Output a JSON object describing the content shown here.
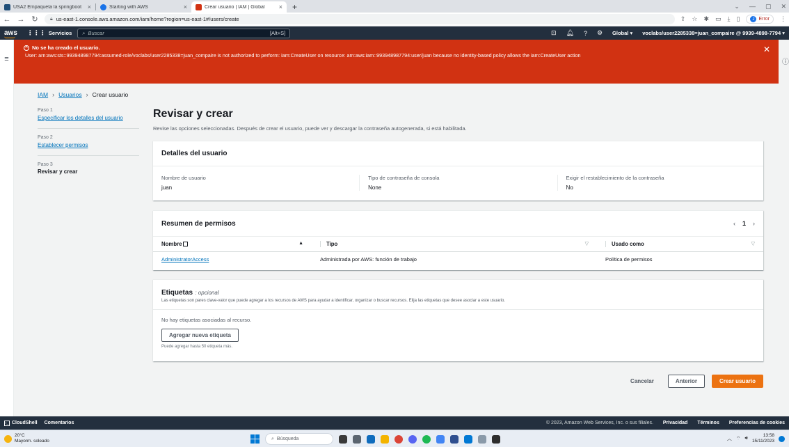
{
  "browser": {
    "tabs": [
      {
        "title": "USA2 Empaqueta la springboot",
        "active": false,
        "favicon_color": "#1f4e79"
      },
      {
        "title": "Starting with AWS",
        "active": false,
        "favicon_color": "#1a73e8"
      },
      {
        "title": "Crear usuario | IAM | Global",
        "active": true,
        "favicon_color": "#d13212"
      }
    ],
    "new_tab": "+",
    "url": "us-east-1.console.aws.amazon.com/iam/home?region=us-east-1#/users/create",
    "profile_label": "Error",
    "profile_initial": "J"
  },
  "aws_nav": {
    "logo": "aws",
    "services": "Servicios",
    "search_placeholder": "Buscar",
    "search_shortcut": "[Alt+S]",
    "region": "Global",
    "account": "voclabs/user2285338=juan_compaire @ 9939-4898-7794"
  },
  "flash": {
    "title": "No se ha creado el usuario.",
    "message": "User: arn:aws:sts::993948987794:assumed-role/voclabs/user2285338=juan_compaire is not authorized to perform: iam:CreateUser on resource: arn:aws:iam::993948987794:user/juan because no identity-based policy allows the iam:CreateUser action"
  },
  "breadcrumb": {
    "items": [
      "IAM",
      "Usuarios"
    ],
    "current": "Crear usuario"
  },
  "steps": [
    {
      "label": "Paso 1",
      "title": "Especificar los detalles del usuario",
      "is_link": true
    },
    {
      "label": "Paso 2",
      "title": "Establecer permisos",
      "is_link": true
    },
    {
      "label": "Paso 3",
      "title": "Revisar y crear",
      "is_link": false
    }
  ],
  "page": {
    "title": "Revisar y crear",
    "description": "Revise las opciones seleccionadas. Después de crear el usuario, puede ver y descargar la contraseña autogenerada, si está habilitada."
  },
  "user_details": {
    "heading": "Detalles del usuario",
    "fields": [
      {
        "key": "Nombre de usuario",
        "value": "juan"
      },
      {
        "key": "Tipo de contraseña de consola",
        "value": "None"
      },
      {
        "key": "Exigir el restablecimiento de la contraseña",
        "value": "No"
      }
    ]
  },
  "permissions": {
    "heading": "Resumen de permisos",
    "page": "1",
    "columns": [
      "Nombre",
      "Tipo",
      "Usado como"
    ],
    "rows": [
      {
        "name": "AdministratorAccess",
        "type": "Administrada por AWS: función de trabajo",
        "used_as": "Política de permisos"
      }
    ]
  },
  "tags": {
    "heading": "Etiquetas",
    "optional": ": opcional",
    "description": "Las etiquetas son pares clave-valor que puede agregar a los recursos de AWS para ayudar a identificar, organizar o buscar recursos. Elija las etiquetas que desee asociar a este usuario.",
    "empty": "No hay etiquetas asociadas al recurso.",
    "add_button": "Agregar nueva etiqueta",
    "hint": "Puede agregar hasta 50 etiqueta más."
  },
  "actions": {
    "cancel": "Cancelar",
    "previous": "Anterior",
    "create": "Crear usuario"
  },
  "footer": {
    "cloudshell": "CloudShell",
    "feedback": "Comentarios",
    "copyright": "© 2023, Amazon Web Services, Inc. o sus filiales.",
    "privacy": "Privacidad",
    "terms": "Términos",
    "cookies": "Preferencias de cookies"
  },
  "taskbar": {
    "temp": "20°C",
    "weather": "Mayorm. soleado",
    "search_placeholder": "Búsqueda",
    "time": "13:58",
    "date": "15/11/2023"
  },
  "colors": {
    "aws_nav": "#232f3e",
    "error": "#d13212",
    "primary": "#ec7211",
    "link": "#0073bb"
  }
}
